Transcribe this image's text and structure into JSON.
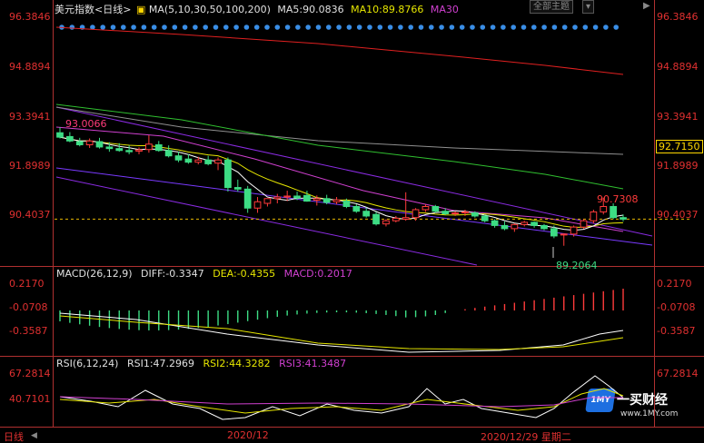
{
  "header": {
    "instrument": "美元指数",
    "period_label": "<日线>",
    "ma_label": "MA(5,10,30,50,100,200)",
    "ma5": "MA5:90.0836",
    "ma10": "MA10:89.8766",
    "ma30": "MA30",
    "theme_button": "全部主题",
    "play_icon": "▶"
  },
  "price_axis": {
    "left": [
      "96.3846",
      "94.8894",
      "93.3941",
      "91.8989",
      "90.4037"
    ],
    "right": [
      "96.3846",
      "94.8894",
      "93.3941",
      "91.8989",
      "90.4037"
    ],
    "current_price": "92.7150"
  },
  "annotations": {
    "high_left": "93.0066",
    "high_right": "90.7308",
    "low": "89.2064"
  },
  "macd": {
    "title": "MACD(26,12,9)",
    "diff": "DIFF:-0.3347",
    "dea": "DEA:-0.4355",
    "macd": "MACD:0.2017",
    "ticks": [
      "0.2170",
      "-0.0708",
      "-0.3587"
    ]
  },
  "rsi": {
    "title": "RSI(6,12,24)",
    "rsi1": "RSI1:47.2969",
    "rsi2": "RSI2:44.3282",
    "rsi3": "RSI3:41.3487",
    "ticks": [
      "67.2814",
      "40.7101"
    ]
  },
  "footer": {
    "period": "日线",
    "month_label": "2020/12",
    "cursor_date": "2020/12/29 星期二"
  },
  "watermark": {
    "site": "一买财经",
    "url": "www.1MY.com",
    "logo": "1MY"
  },
  "colors": {
    "up": "#ff3b3b",
    "down": "#3ddc84",
    "ma5": "#ffffff",
    "ma10": "#e6e600",
    "ma30": "#d040d0",
    "ma_long1": "#30c030",
    "ma_long2": "#909090",
    "ma_long3": "#e02020",
    "axis_text": "#e03030",
    "channel": "#8a2be2"
  },
  "chart_data": {
    "type": "candlestick",
    "title": "美元指数",
    "y_range": [
      88.6,
      96.4
    ],
    "candles": [
      {
        "o": 92.78,
        "h": 92.95,
        "l": 92.6,
        "c": 92.64
      },
      {
        "o": 92.66,
        "h": 92.8,
        "l": 92.48,
        "c": 92.52
      },
      {
        "o": 92.5,
        "h": 92.62,
        "l": 92.35,
        "c": 92.4
      },
      {
        "o": 92.4,
        "h": 92.6,
        "l": 92.3,
        "c": 92.52
      },
      {
        "o": 92.5,
        "h": 92.62,
        "l": 92.28,
        "c": 92.33
      },
      {
        "o": 92.33,
        "h": 92.48,
        "l": 92.18,
        "c": 92.28
      },
      {
        "o": 92.28,
        "h": 92.45,
        "l": 92.18,
        "c": 92.22
      },
      {
        "o": 92.22,
        "h": 92.38,
        "l": 92.1,
        "c": 92.18
      },
      {
        "o": 92.2,
        "h": 92.32,
        "l": 92.1,
        "c": 92.24
      },
      {
        "o": 92.25,
        "h": 92.7,
        "l": 92.15,
        "c": 92.42
      },
      {
        "o": 92.4,
        "h": 92.52,
        "l": 92.18,
        "c": 92.22
      },
      {
        "o": 92.22,
        "h": 92.38,
        "l": 92.0,
        "c": 92.05
      },
      {
        "o": 92.05,
        "h": 92.18,
        "l": 91.85,
        "c": 91.92
      },
      {
        "o": 91.95,
        "h": 92.1,
        "l": 91.8,
        "c": 91.85
      },
      {
        "o": 91.85,
        "h": 92.02,
        "l": 91.78,
        "c": 91.92
      },
      {
        "o": 91.92,
        "h": 92.05,
        "l": 91.75,
        "c": 91.8
      },
      {
        "o": 91.82,
        "h": 92.0,
        "l": 91.6,
        "c": 91.92
      },
      {
        "o": 91.92,
        "h": 92.0,
        "l": 90.92,
        "c": 91.05
      },
      {
        "o": 91.05,
        "h": 91.3,
        "l": 90.92,
        "c": 91.0
      },
      {
        "o": 91.0,
        "h": 91.1,
        "l": 90.25,
        "c": 90.4
      },
      {
        "o": 90.4,
        "h": 90.75,
        "l": 90.25,
        "c": 90.6
      },
      {
        "o": 90.55,
        "h": 90.7,
        "l": 90.45,
        "c": 90.7
      },
      {
        "o": 90.7,
        "h": 90.85,
        "l": 90.55,
        "c": 90.75
      },
      {
        "o": 90.75,
        "h": 90.95,
        "l": 90.62,
        "c": 90.78
      },
      {
        "o": 90.78,
        "h": 90.92,
        "l": 90.65,
        "c": 90.72
      },
      {
        "o": 90.8,
        "h": 90.95,
        "l": 90.6,
        "c": 90.62
      },
      {
        "o": 90.65,
        "h": 90.8,
        "l": 90.48,
        "c": 90.7
      },
      {
        "o": 90.7,
        "h": 90.82,
        "l": 90.52,
        "c": 90.58
      },
      {
        "o": 90.6,
        "h": 90.75,
        "l": 90.52,
        "c": 90.66
      },
      {
        "o": 90.62,
        "h": 90.7,
        "l": 90.4,
        "c": 90.45
      },
      {
        "o": 90.45,
        "h": 90.52,
        "l": 90.25,
        "c": 90.3
      },
      {
        "o": 90.3,
        "h": 90.42,
        "l": 90.1,
        "c": 90.15
      },
      {
        "o": 90.2,
        "h": 90.28,
        "l": 89.85,
        "c": 89.9
      },
      {
        "o": 89.9,
        "h": 90.05,
        "l": 89.82,
        "c": 90.0
      },
      {
        "o": 90.0,
        "h": 90.15,
        "l": 89.95,
        "c": 90.08
      },
      {
        "o": 90.05,
        "h": 90.9,
        "l": 90.0,
        "c": 90.1
      },
      {
        "o": 90.1,
        "h": 90.4,
        "l": 90.0,
        "c": 90.35
      },
      {
        "o": 90.35,
        "h": 90.52,
        "l": 90.28,
        "c": 90.45
      },
      {
        "o": 90.45,
        "h": 90.5,
        "l": 90.25,
        "c": 90.3
      },
      {
        "o": 90.3,
        "h": 90.4,
        "l": 90.18,
        "c": 90.22
      },
      {
        "o": 90.22,
        "h": 90.3,
        "l": 90.15,
        "c": 90.25
      },
      {
        "o": 90.25,
        "h": 90.35,
        "l": 90.15,
        "c": 90.28
      },
      {
        "o": 90.25,
        "h": 90.3,
        "l": 90.1,
        "c": 90.15
      },
      {
        "o": 90.15,
        "h": 90.2,
        "l": 89.95,
        "c": 90.0
      },
      {
        "o": 90.0,
        "h": 90.05,
        "l": 89.78,
        "c": 89.85
      },
      {
        "o": 89.85,
        "h": 89.98,
        "l": 89.7,
        "c": 89.75
      },
      {
        "o": 89.75,
        "h": 89.92,
        "l": 89.65,
        "c": 89.88
      },
      {
        "o": 89.88,
        "h": 90.0,
        "l": 89.82,
        "c": 89.95
      },
      {
        "o": 89.95,
        "h": 89.98,
        "l": 89.78,
        "c": 89.85
      },
      {
        "o": 89.85,
        "h": 89.9,
        "l": 89.7,
        "c": 89.75
      },
      {
        "o": 89.75,
        "h": 89.85,
        "l": 89.45,
        "c": 89.52
      },
      {
        "o": 89.55,
        "h": 89.6,
        "l": 89.21,
        "c": 89.58
      },
      {
        "o": 89.58,
        "h": 89.85,
        "l": 89.5,
        "c": 89.8
      },
      {
        "o": 89.8,
        "h": 90.05,
        "l": 89.75,
        "c": 90.0
      },
      {
        "o": 90.0,
        "h": 90.35,
        "l": 89.92,
        "c": 90.28
      },
      {
        "o": 90.28,
        "h": 90.73,
        "l": 90.2,
        "c": 90.45
      },
      {
        "o": 90.45,
        "h": 90.55,
        "l": 90.05,
        "c": 90.1
      },
      {
        "o": 90.1,
        "h": 90.2,
        "l": 89.98,
        "c": 90.05
      }
    ]
  }
}
